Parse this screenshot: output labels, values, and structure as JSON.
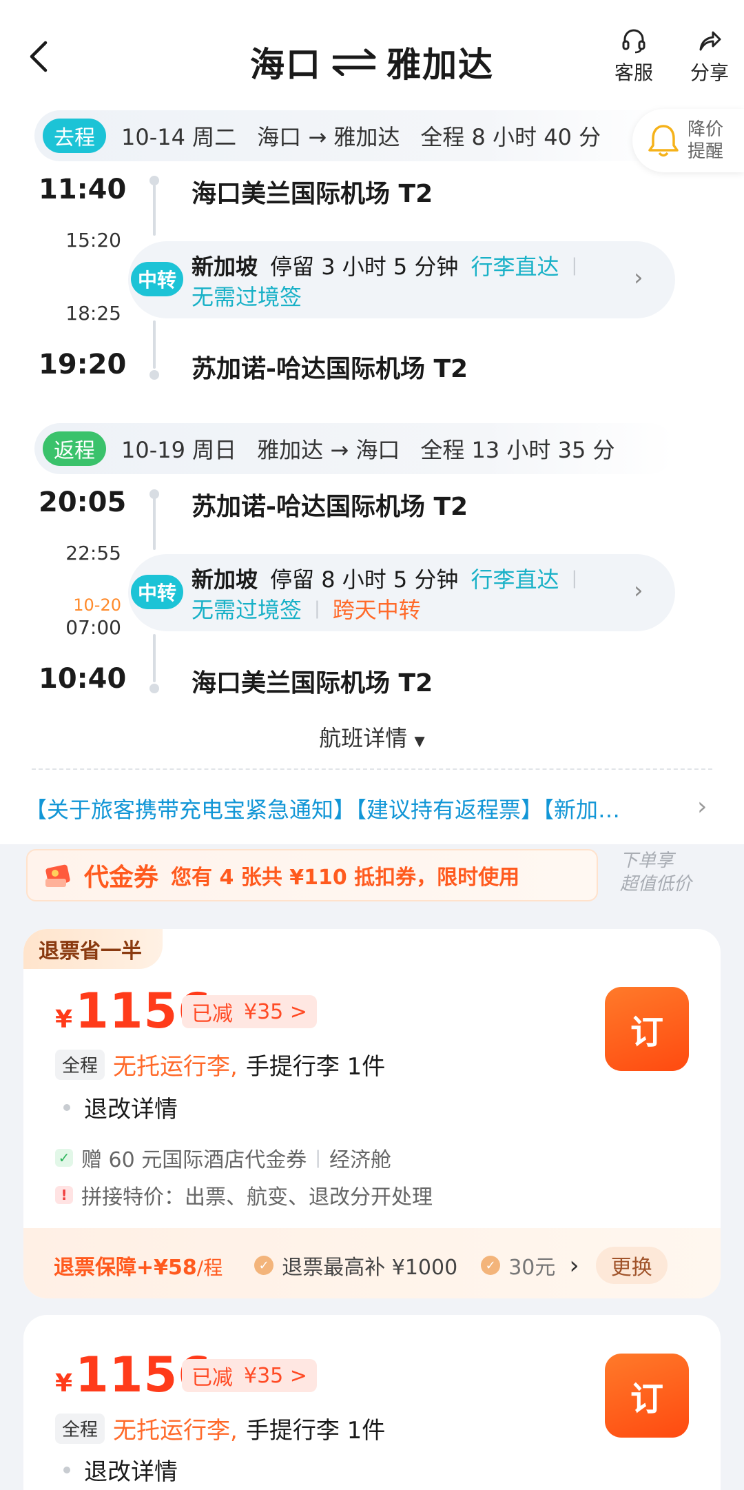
{
  "header": {
    "origin": "海口",
    "destination": "雅加达",
    "service_label": "客服",
    "share_label": "分享"
  },
  "price_alert": {
    "line1": "降价",
    "line2": "提醒"
  },
  "outbound": {
    "tag": "去程",
    "date": "10-14 周二",
    "route": "海口 → 雅加达",
    "duration": "全程 8 小时 40 分",
    "depart_time": "11:40",
    "depart_airport": "海口美兰国际机场 T2",
    "arrive_transfer_time": "15:20",
    "leave_transfer_time": "18:25",
    "transfer_badge": "中转",
    "transfer_city": "新加坡",
    "transfer_stay": "停留 3 小时 5 分钟",
    "baggage_through": "行李直达",
    "no_visa": "无需过境签",
    "arrive_time": "19:20",
    "arrive_airport": "苏加诺-哈达国际机场 T2"
  },
  "return": {
    "tag": "返程",
    "date": "10-19 周日",
    "route": "雅加达 → 海口",
    "duration": "全程 13 小时 35 分",
    "depart_time": "20:05",
    "depart_airport": "苏加诺-哈达国际机场 T2",
    "arrive_transfer_time": "22:55",
    "leave_transfer_date": "10-20",
    "leave_transfer_time": "07:00",
    "transfer_badge": "中转",
    "transfer_city": "新加坡",
    "transfer_stay": "停留 8 小时 5 分钟",
    "baggage_through": "行李直达",
    "no_visa": "无需过境签",
    "overnight": "跨天中转",
    "arrive_time": "10:40",
    "arrive_airport": "海口美兰国际机场 T2"
  },
  "flight_details_label": "航班详情",
  "notices": "【关于旅客携带充电宝紧急通知】【建议持有返程票】【新加…",
  "coupon": {
    "name": "代金券",
    "desc": "您有 4 张共 ¥110 抵扣券，限时使用",
    "aside_line1": "下单享",
    "aside_line2": "超值低价"
  },
  "fares": [
    {
      "tag": "退票省一半",
      "currency": "¥",
      "price": "1156",
      "reduced_label": "已减",
      "reduced_amount": "¥35 >",
      "book_label": "订",
      "scope": "全程",
      "checked_bag": "无托运行李,",
      "carry_on": "手提行李 1件",
      "refund_rules": "退改详情",
      "gift": "赠 60 元国际酒店代金券",
      "cabin": "经济舱",
      "special": "拼接特价：出票、航变、退改分开处理",
      "guarantee_title": "退票保障+¥58",
      "guarantee_unit": "/程",
      "guarantee_item1": "退票最高补 ¥1000",
      "guarantee_item2": "30元",
      "swap_label": "更换"
    },
    {
      "currency": "¥",
      "price": "1156",
      "reduced_label": "已减",
      "reduced_amount": "¥35 >",
      "book_label": "订",
      "scope": "全程",
      "checked_bag": "无托运行李,",
      "carry_on": "手提行李 1件",
      "refund_rules": "退改详情"
    }
  ]
}
